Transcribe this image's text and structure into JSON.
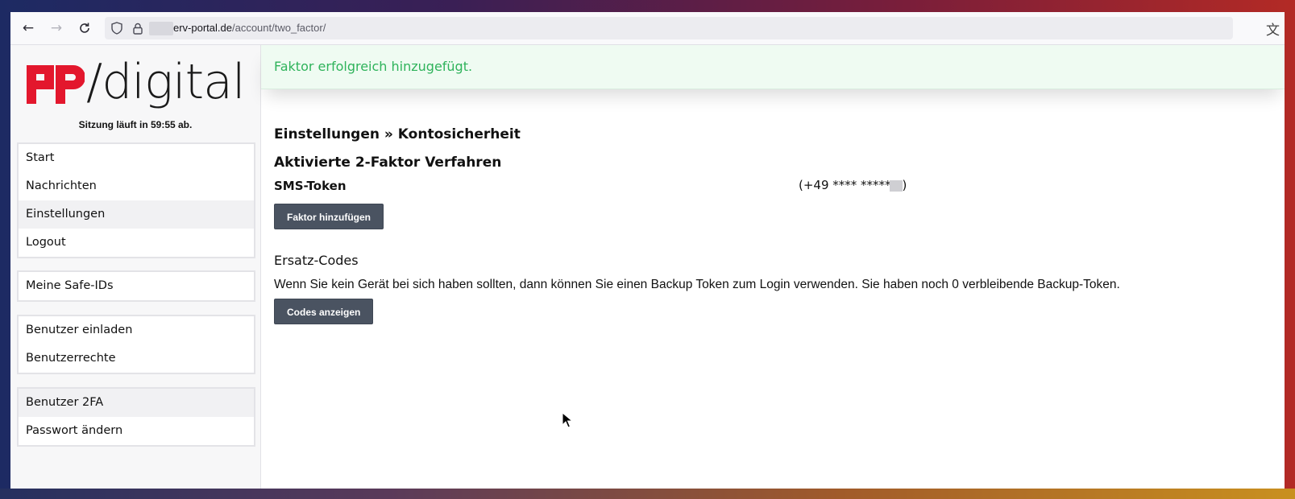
{
  "browser": {
    "url_host": "erv-portal.de",
    "url_path": "/account/two_factor/",
    "icons": [
      "back-icon",
      "forward-icon",
      "reload-icon",
      "shield-icon",
      "lock-icon",
      "translate-icon"
    ]
  },
  "sidebar": {
    "logo_text": "/digital",
    "logo_mark": "FP",
    "session_text": "Sitzung läuft in 59:55 ab.",
    "groups": [
      {
        "items": [
          {
            "label": "Start"
          },
          {
            "label": "Nachrichten"
          },
          {
            "label": "Einstellungen"
          },
          {
            "label": "Logout"
          }
        ]
      },
      {
        "items": [
          {
            "label": "Meine Safe-IDs"
          }
        ]
      },
      {
        "items": [
          {
            "label": "Benutzer einladen"
          },
          {
            "label": "Benutzerrechte"
          }
        ]
      },
      {
        "items": [
          {
            "label": "Benutzer 2FA"
          },
          {
            "label": "Passwort ändern"
          }
        ]
      }
    ]
  },
  "main": {
    "alert_text": "Faktor erfolgreich hinzugefügt.",
    "breadcrumb": "Einstellungen » Kontosicherheit",
    "section_title": "Aktivierte 2-Faktor Verfahren",
    "factor_name": "SMS-Token",
    "factor_phone_prefix": "(+49 **** *****",
    "factor_phone_suffix": ")",
    "add_factor_button": "Faktor hinzufügen",
    "backup_title": "Ersatz-Codes",
    "backup_description": "Wenn Sie kein Gerät bei sich haben sollten, dann können Sie einen Backup Token zum Login verwenden. Sie haben noch 0 verbleibende Backup-Token.",
    "show_codes_button": "Codes anzeigen"
  },
  "colors": {
    "alert_text": "#2fb35b",
    "alert_bg": "#effbf2",
    "button_bg": "#4a5361",
    "logo_red": "#e3172d"
  }
}
